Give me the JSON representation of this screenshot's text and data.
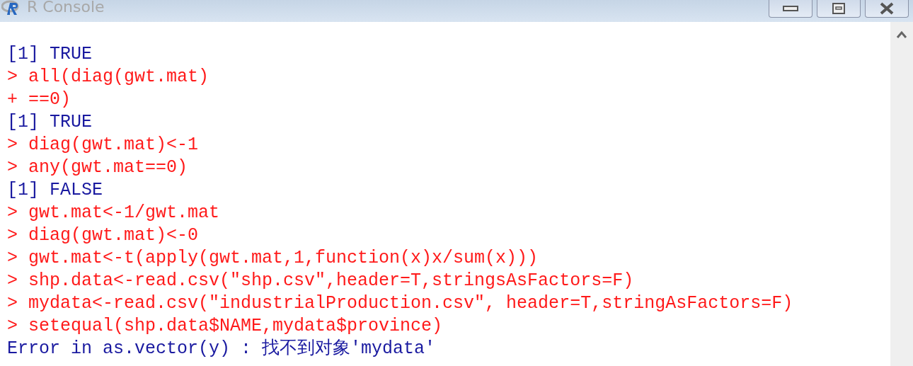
{
  "window": {
    "title": "R Console"
  },
  "console": {
    "lines": [
      {
        "kind": "output",
        "text": "[1] TRUE"
      },
      {
        "kind": "input",
        "text": "> all(diag(gwt.mat)"
      },
      {
        "kind": "input",
        "text": "+ ==0)"
      },
      {
        "kind": "output",
        "text": "[1] TRUE"
      },
      {
        "kind": "input",
        "text": "> diag(gwt.mat)<-1"
      },
      {
        "kind": "input",
        "text": "> any(gwt.mat==0)"
      },
      {
        "kind": "output",
        "text": "[1] FALSE"
      },
      {
        "kind": "input",
        "text": "> gwt.mat<-1/gwt.mat"
      },
      {
        "kind": "input",
        "text": "> diag(gwt.mat)<-0"
      },
      {
        "kind": "input",
        "text": "> gwt.mat<-t(apply(gwt.mat,1,function(x)x/sum(x)))"
      },
      {
        "kind": "input",
        "text": "> shp.data<-read.csv(\"shp.csv\",header=T,stringsAsFactors=F)"
      },
      {
        "kind": "input",
        "text": "> mydata<-read.csv(\"industrialProduction.csv\", header=T,stringAsFactors=F)"
      },
      {
        "kind": "input",
        "text": "> setequal(shp.data$NAME,mydata$province)"
      },
      {
        "kind": "output",
        "text": "Error in as.vector(y) : 找不到对象'mydata'"
      }
    ]
  }
}
